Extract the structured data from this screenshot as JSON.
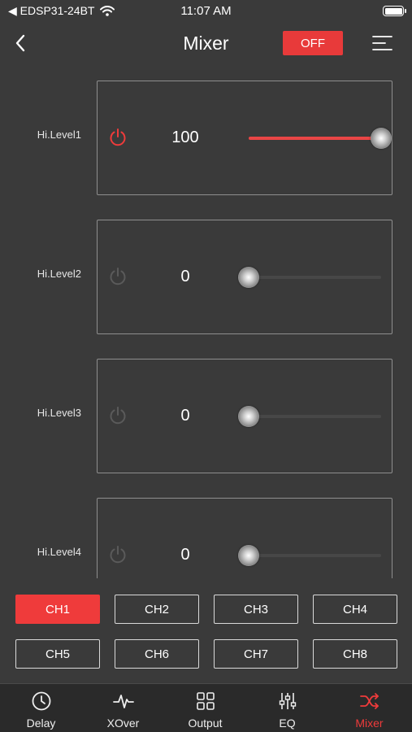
{
  "status": {
    "carrier": "◀ EDSP31-24BT",
    "time": "11:07 AM"
  },
  "header": {
    "title": "Mixer",
    "off_label": "OFF"
  },
  "levels": [
    {
      "label": "Hi.Level1",
      "value": "100",
      "level": 1.0,
      "enabled": true
    },
    {
      "label": "Hi.Level2",
      "value": "0",
      "level": 0.0,
      "enabled": false
    },
    {
      "label": "Hi.Level3",
      "value": "0",
      "level": 0.0,
      "enabled": false
    },
    {
      "label": "Hi.Level4",
      "value": "0",
      "level": 0.0,
      "enabled": false
    }
  ],
  "channels": [
    {
      "label": "CH1",
      "active": true
    },
    {
      "label": "CH2",
      "active": false
    },
    {
      "label": "CH3",
      "active": false
    },
    {
      "label": "CH4",
      "active": false
    },
    {
      "label": "CH5",
      "active": false
    },
    {
      "label": "CH6",
      "active": false
    },
    {
      "label": "CH7",
      "active": false
    },
    {
      "label": "CH8",
      "active": false
    }
  ],
  "tabs": [
    {
      "label": "Delay",
      "icon": "clock-icon",
      "active": false
    },
    {
      "label": "XOver",
      "icon": "waveform-icon",
      "active": false
    },
    {
      "label": "Output",
      "icon": "grid-icon",
      "active": false
    },
    {
      "label": "EQ",
      "icon": "sliders-icon",
      "active": false
    },
    {
      "label": "Mixer",
      "icon": "shuffle-icon",
      "active": true
    }
  ],
  "colors": {
    "accent": "#ef3b3b",
    "background": "#3a3a3a",
    "tabbar": "#2a2a2a",
    "power_off": "#5a5a5a"
  }
}
